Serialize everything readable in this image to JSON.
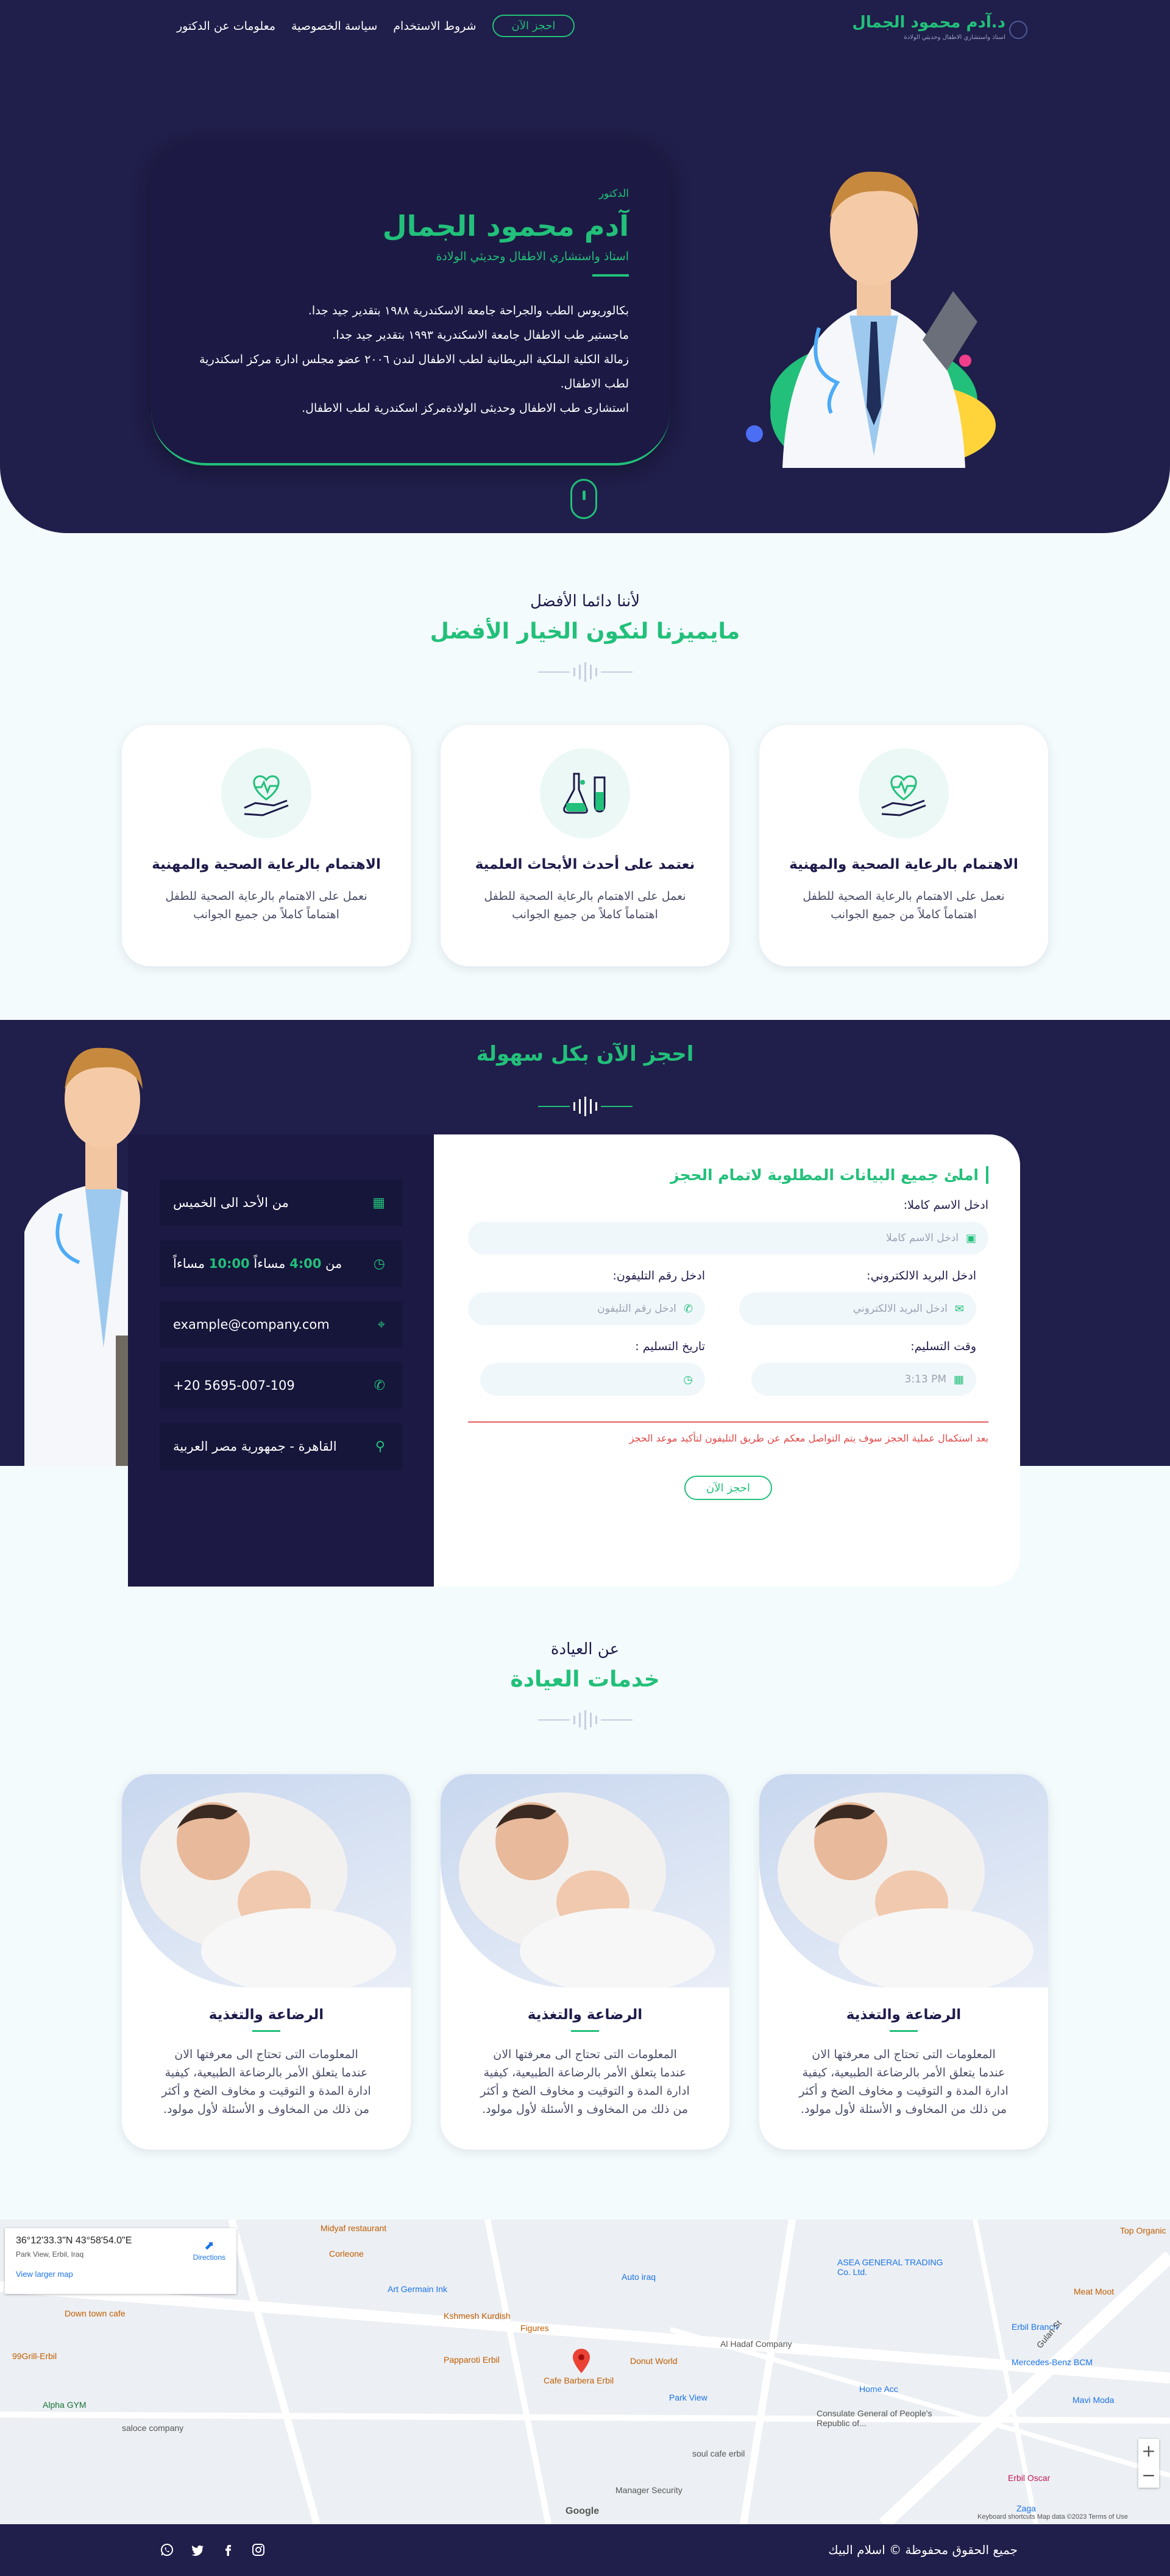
{
  "nav": {
    "logo_name": "د.آدم محمود الجمال",
    "logo_sub": "استاذ واستشاري الاطفال وحديثي الولادة",
    "links": [
      "معلومات عن الدكتور",
      "سياسة الخصوصية",
      "شروط الاستخدام"
    ],
    "book_label": "احجز الآن"
  },
  "hero": {
    "pre_title": "الدكتور",
    "name": "آدم محمود الجمال",
    "role": "استاذ واستشاري الاطفال وحديثي الولادة",
    "bullets": [
      "بكالوريوس الطب والجراحة جامعة الاسكندرية ١٩٨٨ بتقدير جيد جدا.",
      "ماجستير طب الاطفال جامعة الاسكندرية ١٩٩٣ بتقدير جيد جدا.",
      "زمالة الكلية الملكية البريطانية لطب الاطفال لندن ٢٠٠٦ عضو مجلس ادارة مركز اسكندرية لطب الاطفال.",
      "استشارى طب الاطفال وحديثى الولادةمركز اسكندرية لطب الاطفال."
    ]
  },
  "features": {
    "pre": "لأننا دائما الأفضل",
    "title": "مايميزنا لنكون الخيار الأفضل",
    "cards": [
      {
        "icon": "heart-hand-icon",
        "title": "الاهتمام بالرعاية الصحية والمهنية",
        "text": "نعمل على الاهتمام بالرعاية الصحية للطفل اهتماماً كاملاً من جميع الجوانب"
      },
      {
        "icon": "lab-flask-icon",
        "title": "نعتمد على أحدث الأبحاث العلمية",
        "text": "نعمل على الاهتمام بالرعاية الصحية للطفل اهتماماً كاملاً من جميع الجوانب"
      },
      {
        "icon": "heart-hand-icon",
        "title": "الاهتمام بالرعاية الصحية والمهنية",
        "text": "نعمل على الاهتمام بالرعاية الصحية للطفل اهتماماً كاملاً من جميع الجوانب"
      }
    ]
  },
  "booking": {
    "title": "احجز الآن بكل سهولة",
    "info": {
      "days": "من الأحد الى الخميس",
      "hours_from_label": "من",
      "hours_from": "4:00",
      "hours_pm1": "مساءاً",
      "hours_to": "10:00",
      "hours_pm2": "مساءاً",
      "email": "example@company.com",
      "phone": "+20 5695-007-109",
      "address": "القاهرة - جمهورية مصر العربية"
    },
    "form": {
      "title": "املئ جميع البيانات المطلوبة لاتمام الحجز",
      "name_label": "ادخل الاسم كاملا:",
      "name_placeholder": "ادخل الاسم كاملا",
      "phone_label": "ادخل رقم التليفون:",
      "phone_placeholder": "ادخل رقم التليفون",
      "email_label": "ادخل البريد الالكتروني:",
      "email_placeholder": "ادخل البريد الالكتروني",
      "date_label": "تاريخ التسليم :",
      "time_label": "وقت التسليم:",
      "time_value": "3:13 PM",
      "note": "بعد استكمال عملية الحجز سوف يتم التواصل معكم عن طريق التليفون لتأكيد موعد الحجز",
      "submit": "احجز الآن"
    }
  },
  "services": {
    "pre": "عن العيادة",
    "title": "خدمات العيادة",
    "cards": [
      {
        "title": "الرضاعة والتغذية",
        "text": "المعلومات التى تحتاج الى معرفتها الان عندما يتعلق الأمر بالرضاعة الطبيعية، كيفية ادارة المدة و التوقيت و مخاوف الضخ و أكثر من ذلك من المخاوف و الأسئلة لأول مولود."
      },
      {
        "title": "الرضاعة والتغذية",
        "text": "المعلومات التى تحتاج الى معرفتها الان عندما يتعلق الأمر بالرضاعة الطبيعية، كيفية ادارة المدة و التوقيت و مخاوف الضخ و أكثر من ذلك من المخاوف و الأسئلة لأول مولود."
      },
      {
        "title": "الرضاعة والتغذية",
        "text": "المعلومات التى تحتاج الى معرفتها الان عندما يتعلق الأمر بالرضاعة الطبيعية، كيفية ادارة المدة و التوقيت و مخاوف الضخ و أكثر من ذلك من المخاوف و الأسئلة لأول مولود."
      }
    ]
  },
  "map": {
    "coords": "36°12'33.3\"N 43°58'54.0\"E",
    "place": "Park View, Erbil, Iraq",
    "larger_link": "View larger map",
    "directions": "Directions",
    "labels": [
      "Midyaf restaurant",
      "Corleone",
      "Art Germain Ink",
      "Down town cafe",
      "99Grill-Erbil",
      "Kshmesh Kurdish",
      "Figures",
      "Papparoti Erbil",
      "Cafe Barbera Erbil",
      "Donut World",
      "Al Hadaf Company",
      "Auto iraq",
      "ASEA GENERAL TRADING Co. Ltd.",
      "Park View",
      "Home Acc",
      "Consulate General of People's Republic of...",
      "saloce company",
      "Alpha GYM",
      "Manager Security",
      "soul cafe erbil",
      "Mercedes-Benz BCM",
      "Erbil Branch",
      "Meat Moot",
      "Top Organic",
      "Mavi Moda",
      "Erbil Oscar",
      "Zaga",
      "Gulan St"
    ],
    "attrib": "Google",
    "footer_text": "Keyboard shortcuts   Map data ©2023   Terms of Use"
  },
  "footer": {
    "copyright": "جميع الحقوق محفوظة © اسلام البيك",
    "social": [
      "whatsapp-icon",
      "twitter-icon",
      "facebook-icon",
      "instagram-icon"
    ]
  },
  "colors": {
    "navy": "#201e4a",
    "accent": "#22c07a",
    "bg": "#f4fbfc"
  }
}
